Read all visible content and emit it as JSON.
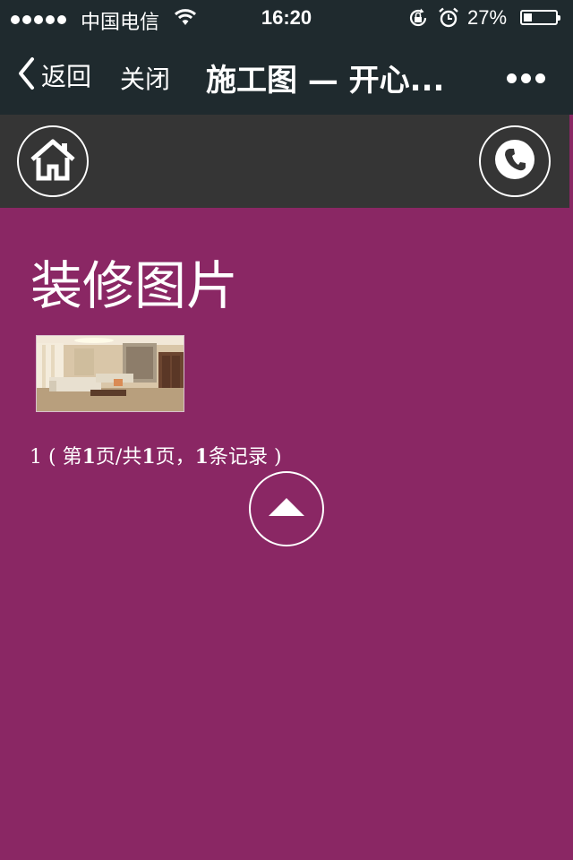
{
  "status_bar": {
    "carrier": "中国电信",
    "time": "16:20",
    "battery_percent": "27%",
    "battery_level": 0.27,
    "icons": [
      "signal-dots-icon",
      "wifi-icon",
      "orientation-lock-icon",
      "alarm-icon",
      "battery-icon"
    ]
  },
  "nav": {
    "back_label": "返回",
    "close_label": "关闭",
    "title": "施工图 — 开心...",
    "icons": [
      "chevron-left-icon",
      "more-dots-icon"
    ]
  },
  "toolbar": {
    "icons": [
      "home-icon",
      "phone-icon"
    ]
  },
  "main": {
    "heading": "装修图片",
    "thumbnail_icon": "living-room-photo",
    "pager": {
      "current_page_link": "1",
      "open_paren": "( ",
      "page_prefix": "第",
      "page_number": "1",
      "page_mid": "页/共",
      "total_pages": "1",
      "total_mid": "页，",
      "record_count": "1",
      "record_suffix": "条记录",
      "close_paren": " )"
    },
    "scroll_top_icon": "arrow-up-icon"
  },
  "colors": {
    "bars": "#1f2a2e",
    "toolbar": "#353535",
    "page_background": "#8a2764",
    "text": "#ffffff"
  }
}
